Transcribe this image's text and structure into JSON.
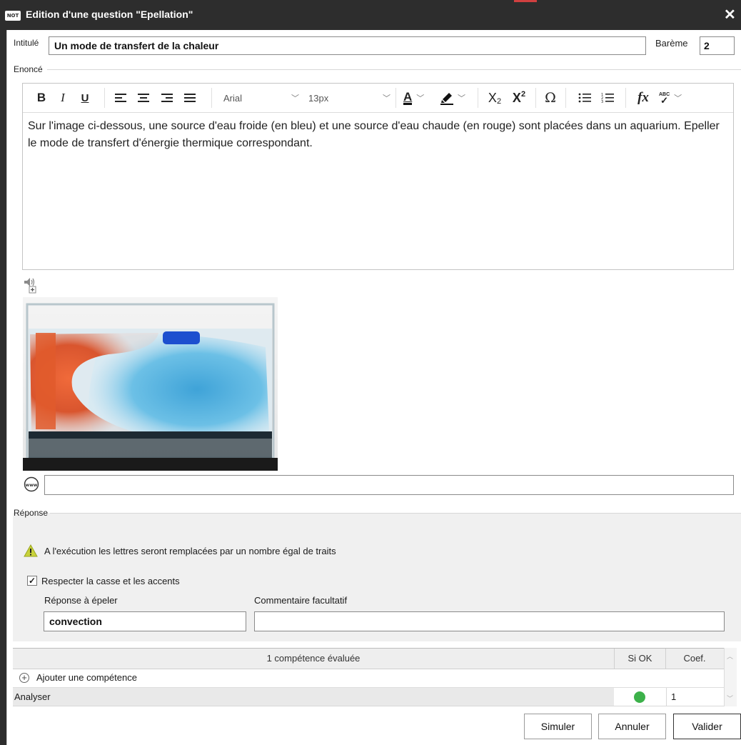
{
  "window": {
    "logo_text": "NOT",
    "title": "Edition d'une question \"Epellation\"",
    "close_glyph": "✕"
  },
  "header": {
    "intitule_label": "Intitulé",
    "intitule_value": "Un mode de transfert de la chaleur",
    "bareme_label": "Barème",
    "bareme_value": "2"
  },
  "enonce": {
    "group_label": "Enoncé",
    "toolbar": {
      "bold": "B",
      "italic": "I",
      "underline": "U",
      "font_family": "Arial",
      "font_size": "13px",
      "text_color_letter": "A",
      "subscript": "X",
      "subscript_digit": "2",
      "superscript": "X",
      "superscript_digit": "2",
      "special_char": "Ω",
      "formula": "fx",
      "spellcheck": "ABC"
    },
    "text": "Sur l'image ci-dessous, une source d'eau froide (en bleu) et une source d'eau chaude (en rouge) sont placées dans un aquarium. Epeller le mode de transfert d'énergie thermique correspondant.",
    "url_value": ""
  },
  "reponse": {
    "group_label": "Réponse",
    "warning": "A l'exécution les lettres seront remplacées par un nombre égal de traits",
    "respect_case_label": "Respecter la casse et les accents",
    "respect_case_checked": true,
    "answer_label": "Réponse à épeler",
    "answer_value": "convection",
    "comment_label": "Commentaire facultatif",
    "comment_value": ""
  },
  "competences": {
    "header_title": "1 compétence évaluée",
    "col_si_ok": "Si OK",
    "col_coef": "Coef.",
    "add_label": "Ajouter une compétence",
    "rows": [
      {
        "name": "Analyser",
        "status_color": "#3cb14a",
        "coef": "1"
      }
    ]
  },
  "buttons": {
    "simuler": "Simuler",
    "annuler": "Annuler",
    "valider": "Valider"
  }
}
